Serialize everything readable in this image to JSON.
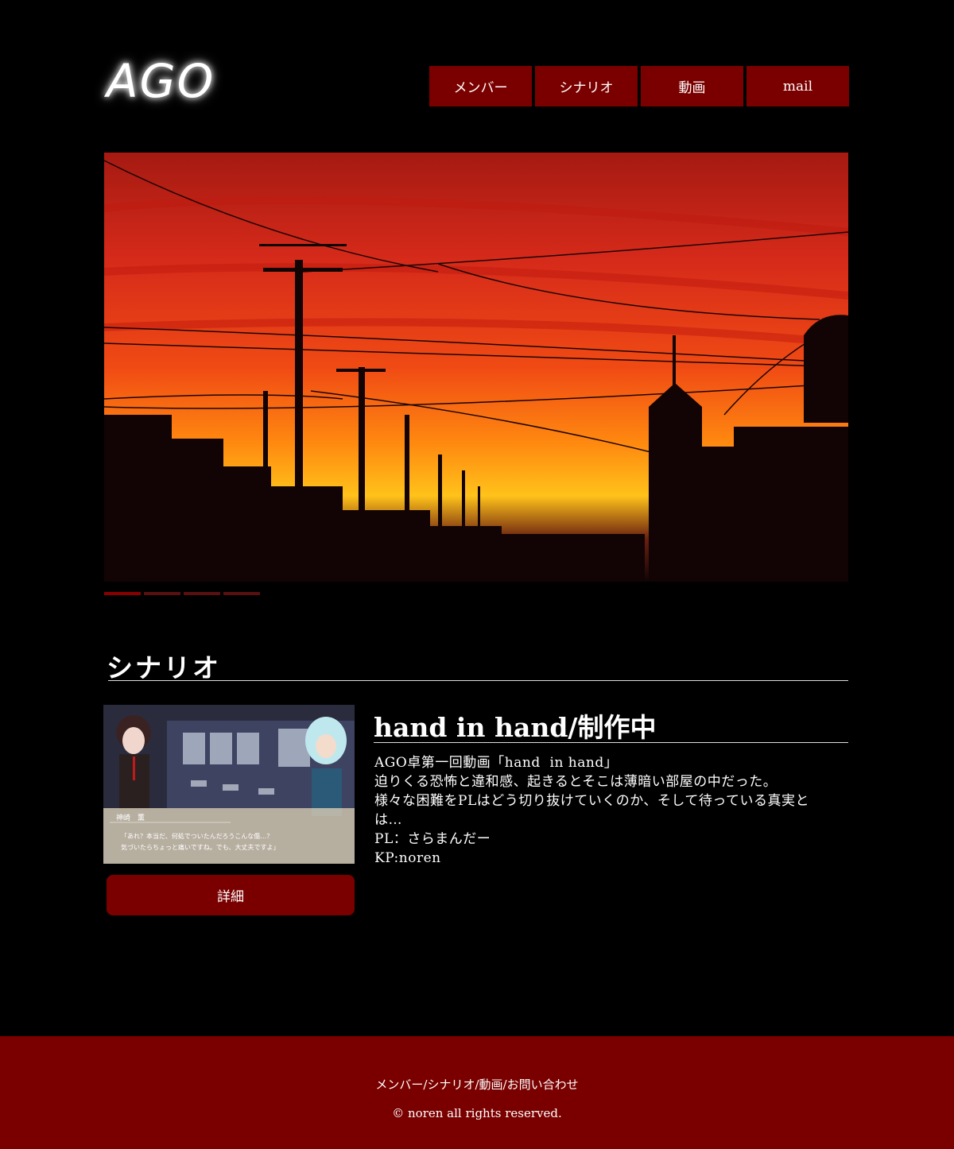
{
  "header": {
    "logo": "AGO",
    "nav": [
      "メンバー",
      "シナリオ",
      "動画",
      "mail"
    ]
  },
  "hero": {
    "image_subject": "sunset-street-utility-poles",
    "slide_count": 4,
    "active_slide": 1
  },
  "section": {
    "title": "シナリオ"
  },
  "entry": {
    "title": "hand in hand/制作中",
    "lines": [
      "AGO卓第一回動画「hand  in hand」",
      "迫りくる恐怖と違和感、起きるとそこは薄暗い部屋の中だった。",
      "様々な困難をPLはどう切り抜けていくのか、そして待っている真実と",
      "は…",
      "PL：さらまんだー",
      "KP:noren"
    ],
    "thumbnail": {
      "speaker_name": "神崎　薫",
      "dialogue_1": "「あれ？本当だ、何処でついたんだろうこんな傷…？",
      "dialogue_2": "気づいたらちょっと痛いですね。でも、大丈夫ですよ」"
    },
    "detail_button": "詳細"
  },
  "footer": {
    "links": [
      "メンバー",
      "シナリオ",
      "動画",
      "お問い合わせ"
    ],
    "separator": "/",
    "copyright": "© noren all rights reserved."
  },
  "colors": {
    "background": "#000000",
    "accent": "#7a0000",
    "text": "#ffffff"
  }
}
